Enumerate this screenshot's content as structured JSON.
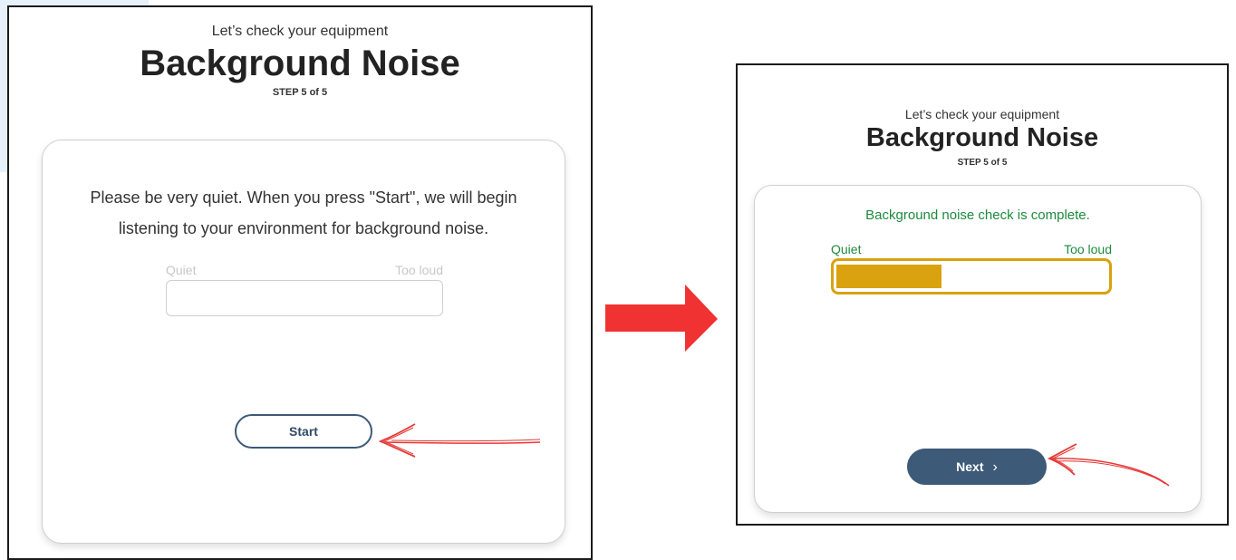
{
  "left_screen": {
    "pre_title": "Let’s check your equipment",
    "title": "Background Noise",
    "step": "STEP 5 of 5",
    "instructions": "Please be very quiet. When you press \"Start\", we will begin listening to your environment for background noise.",
    "scale_low": "Quiet",
    "scale_high": "Too loud",
    "start_label": "Start"
  },
  "right_screen": {
    "pre_title": "Let’s check your equipment",
    "title": "Background Noise",
    "step": "STEP 5 of 5",
    "status": "Background noise check is complete.",
    "scale_low": "Quiet",
    "scale_high": "Too loud",
    "noise_level_fraction": 0.39,
    "next_label": "Next",
    "next_icon": "chevron-right-icon"
  },
  "colors": {
    "accent_navy": "#3d5a78",
    "success_green": "#1e8a3c",
    "meter_amber": "#d9a20e",
    "arrow_red": "#f03232"
  }
}
